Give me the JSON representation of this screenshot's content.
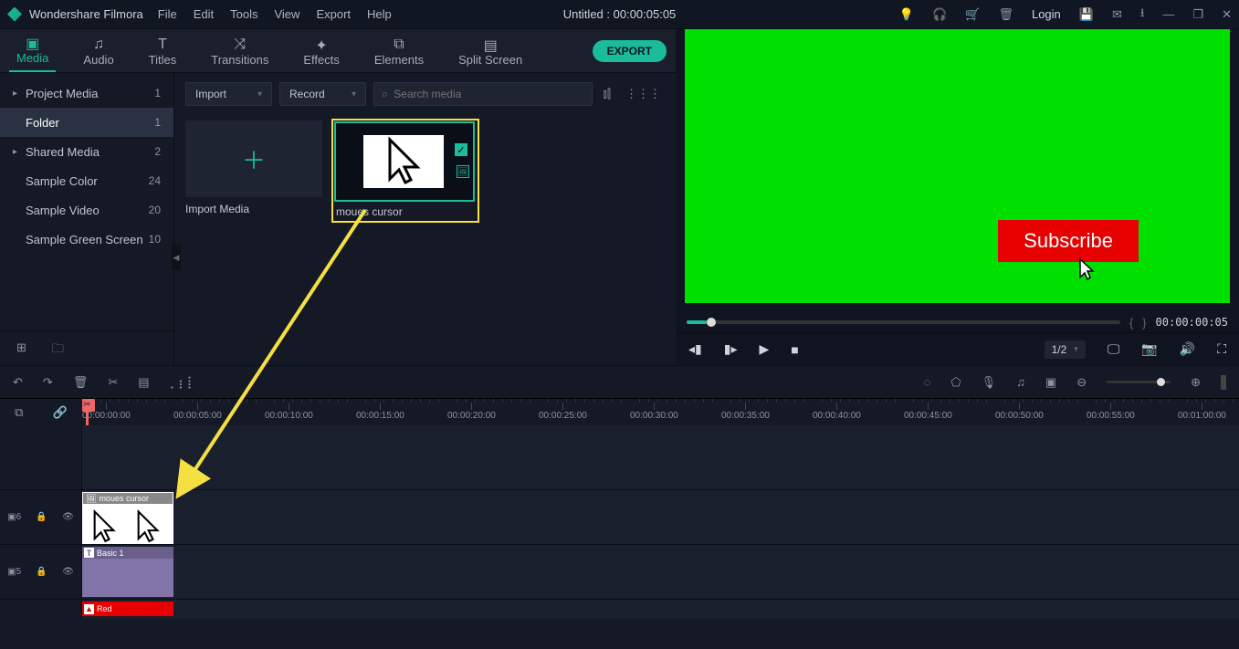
{
  "app": {
    "name": "Wondershare Filmora"
  },
  "menu": {
    "items": [
      "File",
      "Edit",
      "Tools",
      "View",
      "Export",
      "Help"
    ]
  },
  "document": {
    "title": "Untitled : 00:00:05:05"
  },
  "titlebar": {
    "login": "Login"
  },
  "tabs": {
    "items": [
      {
        "label": "Media",
        "active": true
      },
      {
        "label": "Audio"
      },
      {
        "label": "Titles"
      },
      {
        "label": "Transitions"
      },
      {
        "label": "Effects"
      },
      {
        "label": "Elements"
      },
      {
        "label": "Split Screen"
      }
    ],
    "export": "EXPORT"
  },
  "sidebar": {
    "items": [
      {
        "label": "Project Media",
        "count": "1",
        "arrow": true
      },
      {
        "label": "Folder",
        "count": "1",
        "selected": true
      },
      {
        "label": "Shared Media",
        "count": "2",
        "arrow": true
      },
      {
        "label": "Sample Color",
        "count": "24"
      },
      {
        "label": "Sample Video",
        "count": "20"
      },
      {
        "label": "Sample Green Screen",
        "count": "10"
      }
    ]
  },
  "mediabar": {
    "import": "Import",
    "record": "Record",
    "search_placeholder": "Search media"
  },
  "thumbnails": {
    "import_label": "Import Media",
    "cursor_label": "moues cursor"
  },
  "preview": {
    "subscribe": "Subscribe",
    "timecode": "00:00:00:05",
    "ratio": "1/2"
  },
  "ruler": {
    "ticks": [
      "00:00:00:00",
      "00:00:05:00",
      "00:00:10:00",
      "00:00:15:00",
      "00:00:20:00",
      "00:00:25:00",
      "00:00:30:00",
      "00:00:35:00",
      "00:00:40:00",
      "00:00:45:00",
      "00:00:50:00",
      "00:00:55:00",
      "00:01:00:00"
    ]
  },
  "tracks": {
    "cursor_clip": "moues cursor",
    "title_clip": "Basic 1",
    "red_clip": "Red",
    "t1_num": "6",
    "t2_num": "5"
  }
}
